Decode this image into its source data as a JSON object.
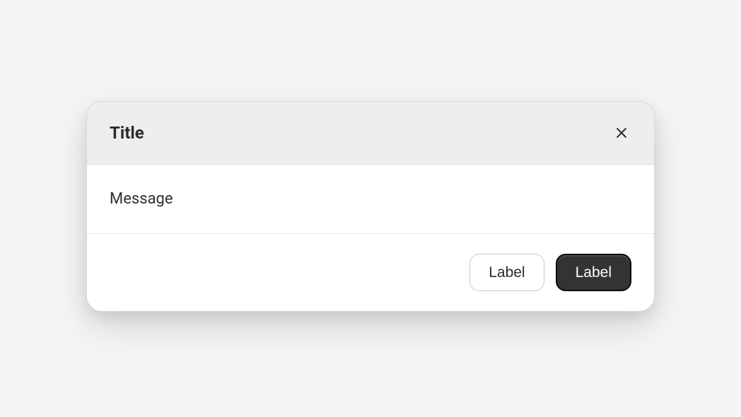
{
  "dialog": {
    "title": "Title",
    "message": "Message",
    "close_icon": "close",
    "buttons": {
      "secondary": "Label",
      "primary": "Label"
    }
  }
}
